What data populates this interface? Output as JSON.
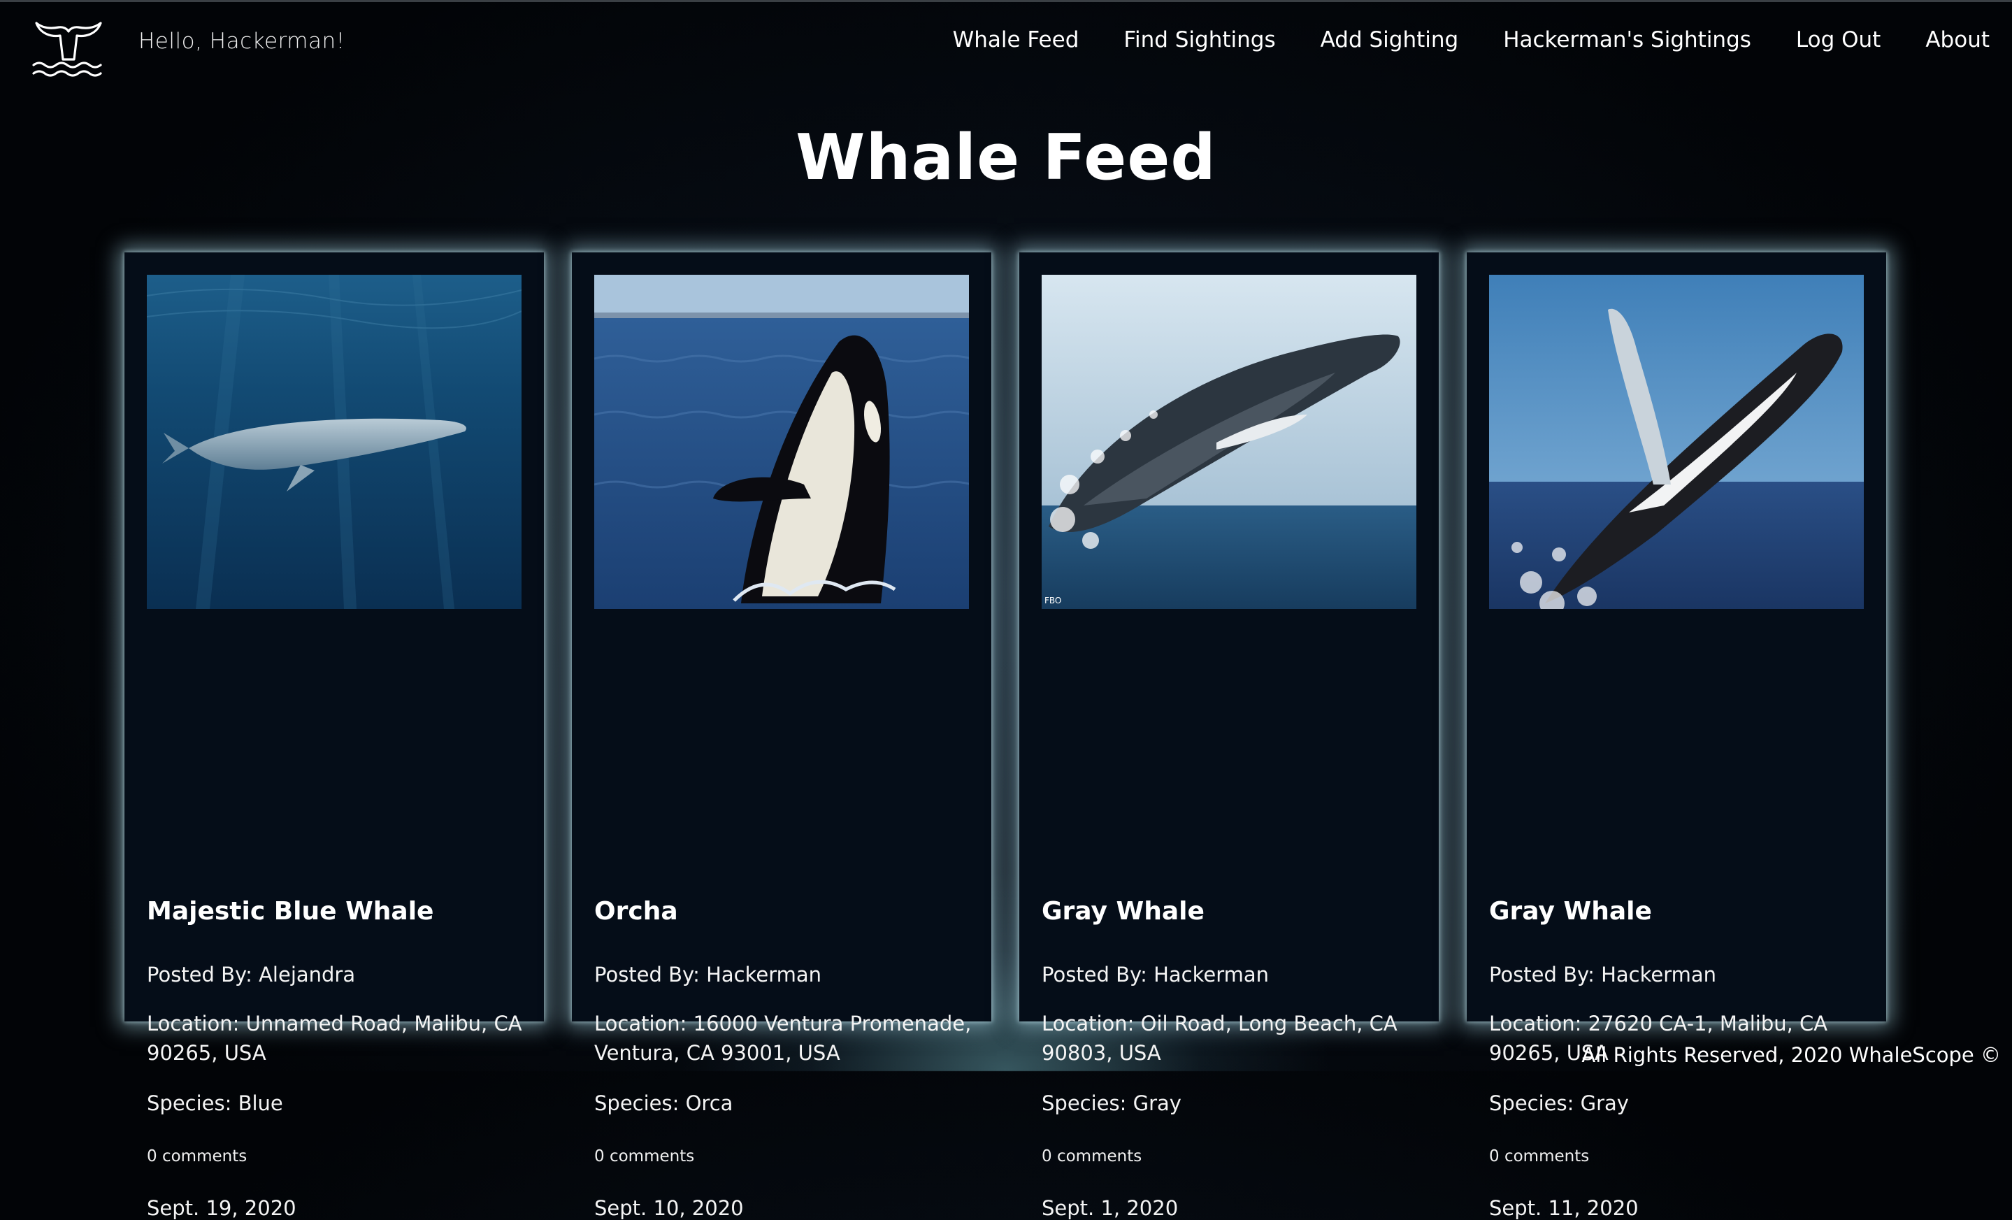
{
  "header": {
    "greeting": "Hello, Hackerman!",
    "logo_icon": "whale-tail-icon",
    "nav": [
      {
        "label": "Whale Feed"
      },
      {
        "label": "Find Sightings"
      },
      {
        "label": "Add Sighting"
      },
      {
        "label": "Hackerman's Sightings"
      },
      {
        "label": "Log Out"
      },
      {
        "label": "About"
      }
    ]
  },
  "page": {
    "title": "Whale Feed"
  },
  "cards": [
    {
      "title": "Majestic Blue Whale",
      "posted_by": "Posted By: Alejandra",
      "location": "Location: Unnamed Road, Malibu, CA 90265, USA",
      "species": "Species: Blue",
      "comments": "0 comments",
      "date": "Sept. 19, 2020",
      "image": "underwater-blue-whale-photo"
    },
    {
      "title": "Orcha",
      "posted_by": "Posted By: Hackerman",
      "location": "Location: 16000 Ventura Promenade, Ventura, CA 93001, USA",
      "species": "Species: Orca",
      "comments": "0 comments",
      "date": "Sept. 10, 2020",
      "image": "orca-spyhop-photo"
    },
    {
      "title": "Gray Whale",
      "posted_by": "Posted By: Hackerman",
      "location": "Location: Oil Road, Long Beach, CA 90803, USA",
      "species": "Species: Gray",
      "comments": "0 comments",
      "date": "Sept. 1, 2020",
      "image": "breaching-whale-photo"
    },
    {
      "title": "Gray Whale",
      "posted_by": "Posted By: Hackerman",
      "location": "Location: 27620 CA-1, Malibu, CA 90265, USA",
      "species": "Species: Gray",
      "comments": "0 comments",
      "date": "Sept. 11, 2020",
      "image": "breaching-humpback-photo"
    }
  ],
  "footer": {
    "text": "All Rights Reserved, 2020 WhaleScope ©"
  },
  "colors": {
    "background": "#060b12",
    "card": "#050d18",
    "glow": "#aad7e6",
    "text": "#ffffff"
  }
}
